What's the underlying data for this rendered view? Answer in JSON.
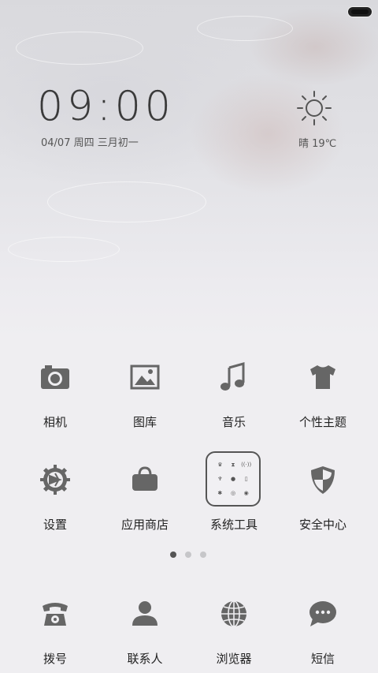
{
  "lockscreen": {
    "time": "09:00",
    "date": "04/07 周四 三月初一",
    "weather": "晴  19℃",
    "weather_icon": "sun-icon"
  },
  "apps_row1": [
    {
      "label": "相机",
      "icon": "camera-icon"
    },
    {
      "label": "图库",
      "icon": "gallery-icon"
    },
    {
      "label": "音乐",
      "icon": "music-icon"
    },
    {
      "label": "个性主题",
      "icon": "tshirt-icon"
    }
  ],
  "apps_row2": [
    {
      "label": "设置",
      "icon": "gear-icon"
    },
    {
      "label": "应用商店",
      "icon": "shopping-bag-icon"
    },
    {
      "label": "系统工具",
      "icon": "folder-icon"
    },
    {
      "label": "安全中心",
      "icon": "shield-icon"
    }
  ],
  "pager": {
    "pages": 3,
    "current": 1
  },
  "dock": [
    {
      "label": "拨号",
      "icon": "phone-icon"
    },
    {
      "label": "联系人",
      "icon": "contact-icon"
    },
    {
      "label": "浏览器",
      "icon": "globe-icon"
    },
    {
      "label": "短信",
      "icon": "message-icon"
    }
  ],
  "colors": {
    "icon": "#666666",
    "text": "#222222",
    "background": "#efeef1"
  }
}
